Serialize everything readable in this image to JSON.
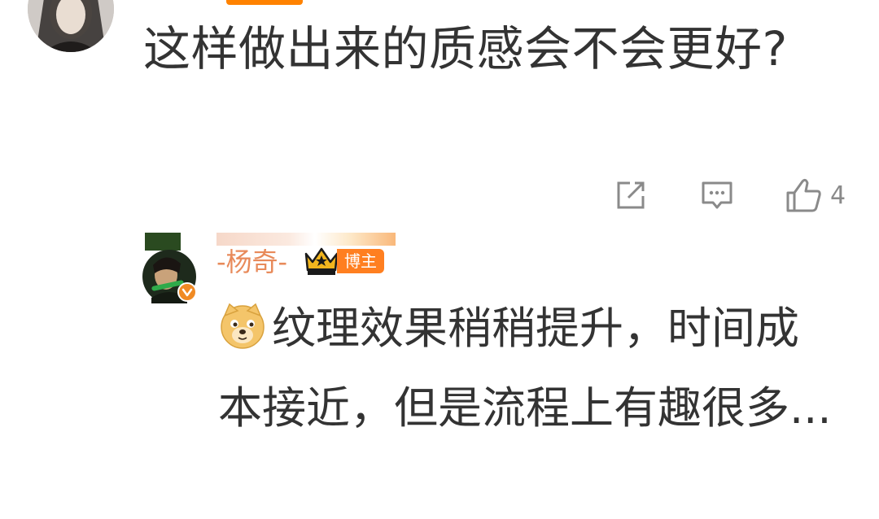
{
  "comment": {
    "text": "这样做出来的质感会不会更好?",
    "actions": {
      "share_icon": "share-icon",
      "reply_icon": "comment-icon",
      "like_icon": "thumbs-up-icon",
      "like_count": "4"
    }
  },
  "reply": {
    "username": "-杨奇-",
    "badge_label": "博主",
    "emoji": "doge-emoji",
    "text": "纹理效果稍稍提升，时间成本接近，但是流程上有趣很多..."
  },
  "colors": {
    "accent": "#ff8200",
    "username": "#e88a5a",
    "text": "#333333",
    "muted": "#8a8a8a"
  }
}
